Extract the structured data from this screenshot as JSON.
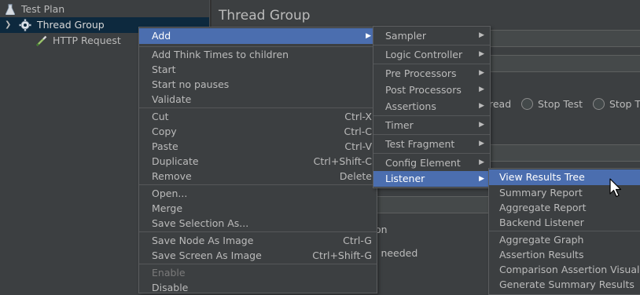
{
  "tree": {
    "items": [
      {
        "label": "Test Plan",
        "icon": "flask-icon"
      },
      {
        "label": "Thread Group",
        "icon": "gear-icon"
      },
      {
        "label": "HTTP Request",
        "icon": "pipette-icon"
      }
    ]
  },
  "editor": {
    "title": "Thread Group",
    "partial_texts": {
      "read": "read",
      "stop_test": "Stop Test",
      "stop_t": "Stop T",
      "on": "on",
      "l_needed": "l needed"
    }
  },
  "context_menu": {
    "add": "Add",
    "add_think_times": "Add Think Times to children",
    "start": "Start",
    "start_no_pauses": "Start no pauses",
    "validate": "Validate",
    "cut": "Cut",
    "cut_key": "Ctrl-X",
    "copy": "Copy",
    "copy_key": "Ctrl-C",
    "paste": "Paste",
    "paste_key": "Ctrl-V",
    "duplicate": "Duplicate",
    "duplicate_key": "Ctrl+Shift-C",
    "remove": "Remove",
    "remove_key": "Delete",
    "open": "Open...",
    "merge": "Merge",
    "save_selection_as": "Save Selection As...",
    "save_node_as_image": "Save Node As Image",
    "save_node_key": "Ctrl-G",
    "save_screen_as_image": "Save Screen As Image",
    "save_screen_key": "Ctrl+Shift-G",
    "enable": "Enable",
    "disable": "Disable"
  },
  "add_submenu": {
    "sampler": "Sampler",
    "logic_controller": "Logic Controller",
    "pre_processors": "Pre Processors",
    "post_processors": "Post Processors",
    "assertions": "Assertions",
    "timer": "Timer",
    "test_fragment": "Test Fragment",
    "config_element": "Config Element",
    "listener": "Listener"
  },
  "listener_submenu": {
    "view_results_tree": "View Results Tree",
    "summary_report": "Summary Report",
    "aggregate_report": "Aggregate Report",
    "backend_listener": "Backend Listener",
    "aggregate_graph": "Aggregate Graph",
    "assertion_results": "Assertion Results",
    "comparison_assertion_visual": "Comparison Assertion Visual",
    "generate_summary_results": "Generate Summary Results"
  },
  "colors": {
    "background": "#3c3f41",
    "highlight": "#4b6eaf",
    "selection": "#0d293e",
    "text": "#bbbbbb",
    "disabled_text": "#7a7a7a"
  }
}
